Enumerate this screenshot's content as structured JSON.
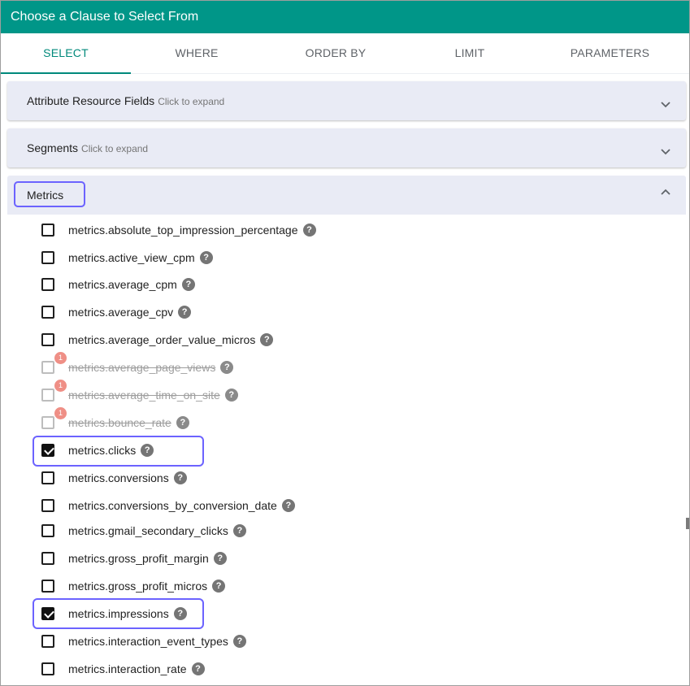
{
  "window": {
    "title": "Choose a Clause to Select From"
  },
  "tabs": [
    {
      "label": "SELECT",
      "active": true
    },
    {
      "label": "WHERE",
      "active": false
    },
    {
      "label": "ORDER BY",
      "active": false
    },
    {
      "label": "LIMIT",
      "active": false
    },
    {
      "label": "PARAMETERS",
      "active": false
    }
  ],
  "panels": {
    "attribute": {
      "title": "Attribute Resource Fields",
      "hint": "Click to expand",
      "expanded": false
    },
    "segments": {
      "title": "Segments",
      "hint": "Click to expand",
      "expanded": false
    },
    "metrics": {
      "title": "Metrics",
      "expanded": true
    }
  },
  "help_glyph": "?",
  "metrics": [
    {
      "label": "metrics.absolute_top_impression_percentage",
      "checked": false,
      "disabled": false
    },
    {
      "label": "metrics.active_view_cpm",
      "checked": false,
      "disabled": false
    },
    {
      "label": "metrics.average_cpm",
      "checked": false,
      "disabled": false
    },
    {
      "label": "metrics.average_cpv",
      "checked": false,
      "disabled": false
    },
    {
      "label": "metrics.average_order_value_micros",
      "checked": false,
      "disabled": false
    },
    {
      "label": "metrics.average_page_views",
      "checked": false,
      "disabled": true,
      "badge": "1"
    },
    {
      "label": "metrics.average_time_on_site",
      "checked": false,
      "disabled": true,
      "badge": "1"
    },
    {
      "label": "metrics.bounce_rate",
      "checked": false,
      "disabled": true,
      "badge": "1"
    },
    {
      "label": "metrics.clicks",
      "checked": true,
      "disabled": false
    },
    {
      "label": "metrics.conversions",
      "checked": false,
      "disabled": false
    },
    {
      "label": "metrics.conversions_by_conversion_date",
      "checked": false,
      "disabled": false
    },
    {
      "label": "metrics.gmail_secondary_clicks",
      "checked": false,
      "disabled": false
    },
    {
      "label": "metrics.gross_profit_margin",
      "checked": false,
      "disabled": false
    },
    {
      "label": "metrics.gross_profit_micros",
      "checked": false,
      "disabled": false
    },
    {
      "label": "metrics.impressions",
      "checked": true,
      "disabled": false
    },
    {
      "label": "metrics.interaction_event_types",
      "checked": false,
      "disabled": false
    },
    {
      "label": "metrics.interaction_rate",
      "checked": false,
      "disabled": false
    }
  ],
  "colors": {
    "header": "#009688",
    "accent": "#00897b",
    "highlight": "#6c63ff",
    "badge": "#ef8f86"
  }
}
